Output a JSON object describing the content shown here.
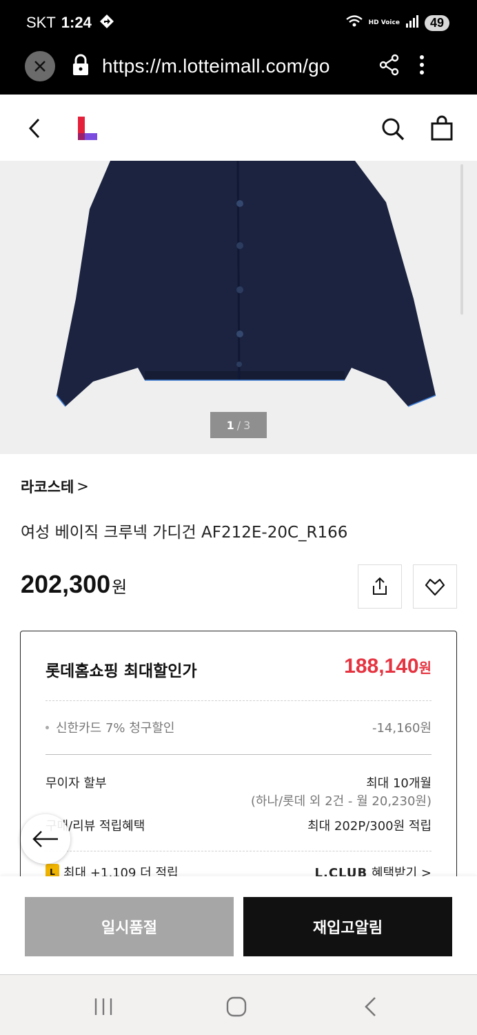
{
  "status_bar": {
    "carrier": "SKT",
    "time": "1:24",
    "hd_voice": "HD Voice",
    "battery": "49"
  },
  "browser": {
    "url": "https://m.lotteimall.com/go"
  },
  "product": {
    "image_pager": {
      "current": "1",
      "separator": "/",
      "total": "3"
    },
    "brand": "라코스테",
    "brand_chevron": ">",
    "name": "여성 베이직 크루넥 가디건 AF212E-20C_R166",
    "price": "202,300",
    "price_unit": "원"
  },
  "benefits": {
    "title": "롯데홈쇼핑 최대할인가",
    "best_price": "188,140",
    "best_price_unit": "원",
    "accent_color": "#e53340",
    "card_discount_label": "신한카드 7% 청구할인",
    "card_discount_value": "-14,160원",
    "installment_label": "무이자 할부",
    "installment_value": "최대 10개월",
    "installment_sub": "(하나/롯데 외 2건 - 월 20,230원)",
    "points_label": "구매/리뷰 적립혜택",
    "points_value": "최대 202P/300원 적립",
    "extra_label": "최대 +1,109 더 적립",
    "extra_badge": "L",
    "lclub": "L.CLUB",
    "lclub_action": "혜택받기 >"
  },
  "actions": {
    "sold_out": "일시품절",
    "restock_alert": "재입고알림"
  }
}
